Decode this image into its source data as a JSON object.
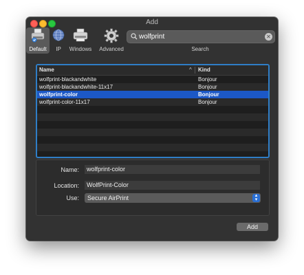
{
  "window": {
    "title": "Add"
  },
  "toolbar": {
    "default_label": "Default",
    "ip_label": "IP",
    "windows_label": "Windows",
    "advanced_label": "Advanced"
  },
  "search": {
    "value": "wolfprint",
    "label": "Search"
  },
  "table": {
    "columns": {
      "name": "Name",
      "kind": "Kind"
    },
    "rows": [
      {
        "name": "wolfprint-blackandwhite",
        "kind": "Bonjour"
      },
      {
        "name": "wolfprint-blackandwhite-11x17",
        "kind": "Bonjour"
      },
      {
        "name": "wolfprint-color",
        "kind": "Bonjour"
      },
      {
        "name": "wolfprint-color-11x17",
        "kind": "Bonjour"
      }
    ],
    "selected_index": 2
  },
  "form": {
    "name_label": "Name:",
    "name_value": "wolfprint-color",
    "location_label": "Location:",
    "location_value": "WolfPrint-Color",
    "use_label": "Use:",
    "use_value": "Secure AirPrint"
  },
  "actions": {
    "add_label": "Add"
  },
  "colors": {
    "accent": "#2f7ec7",
    "selection": "#1c58c6"
  }
}
